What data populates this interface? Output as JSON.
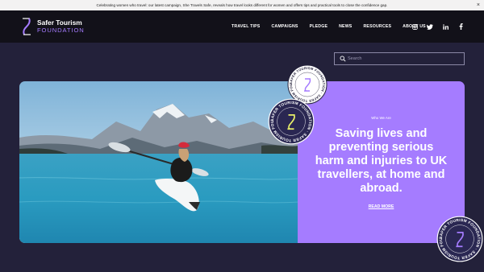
{
  "announcement": {
    "text": "Celebrating women who travel: our latest campaign, She Travels Safe, reveals how travel looks different for women and offers tips and practical tools to close the confidence gap.",
    "close": "×"
  },
  "brand": {
    "line1": "Safer Tourism",
    "line2": "FOUNDATION"
  },
  "nav": {
    "items": [
      {
        "label": "TRAVEL TIPS"
      },
      {
        "label": "CAMPAIGNS"
      },
      {
        "label": "PLEDGE"
      },
      {
        "label": "NEWS"
      },
      {
        "label": "RESOURCES"
      },
      {
        "label": "ABOUT US"
      }
    ]
  },
  "socials": [
    "instagram-icon",
    "twitter-icon",
    "linkedin-icon",
    "facebook-icon"
  ],
  "search": {
    "placeholder": "Search"
  },
  "hero": {
    "eyebrow": "Who We Are",
    "heading": "Saving lives and preventing serious harm and injuries to UK travellers, at home and abroad.",
    "link": "READ MORE"
  },
  "badge": {
    "ring_text": "SAFER TOURISM FOUNDATION · SAFER TOURISM FOUNDATION · "
  },
  "colors": {
    "accent": "#a57cff",
    "header": "#121119",
    "page": "#23213a",
    "badge_dark": "#2a2752"
  }
}
